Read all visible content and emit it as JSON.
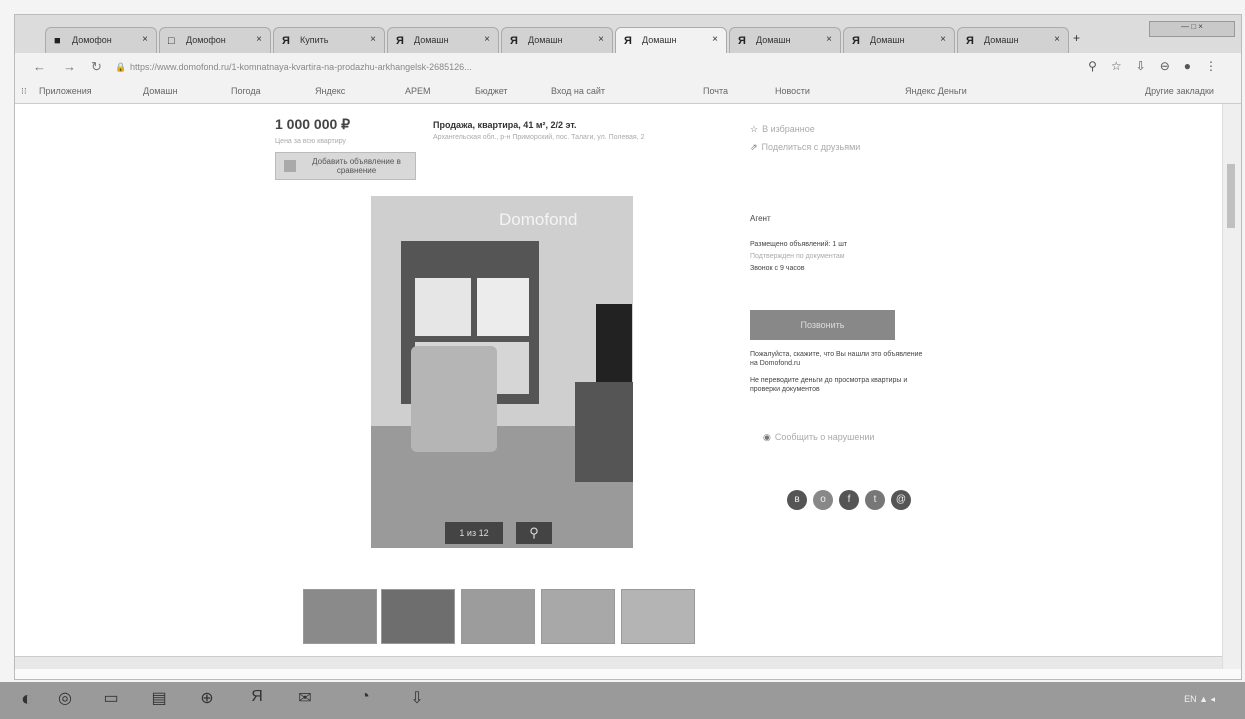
{
  "browser": {
    "tabs": [
      {
        "icon": "■",
        "label": "Домофон"
      },
      {
        "icon": "□",
        "label": "Домофон"
      },
      {
        "icon": "Я",
        "label": "Купить"
      },
      {
        "icon": "Я",
        "label": "Домашн"
      },
      {
        "icon": "Я",
        "label": "Домашн"
      },
      {
        "icon": "Я",
        "label": "Домашн"
      },
      {
        "icon": "Я",
        "label": "Домашн"
      },
      {
        "icon": "Я",
        "label": "Домашн"
      },
      {
        "icon": "Я",
        "label": "Домашн"
      }
    ],
    "active_tab_index": 5,
    "close_glyph": "×",
    "new_tab_glyph": "+",
    "window_controls_label": "— □ ×",
    "url": "https://www.domofond.ru/1-komnatnaya-kvartira-na-prodazhu-arkhangelsk-2685126...",
    "bookmarks": [
      "Приложения",
      "Домашн",
      "Погода",
      "Яндекс",
      "АРЕМ",
      "Бюджет",
      "Вход на сайт",
      "Почта",
      "Новости",
      "Яндекс Деньги"
    ],
    "bookmarks_right": "Другие закладки"
  },
  "listing": {
    "price": "1 000 000 ₽",
    "price_note": "Цена за всю квартиру",
    "compare_label": "Добавить объявление в сравнение",
    "title": "Продажа, квартира, 41 м², 2/2 эт.",
    "address": "Архангельская обл., р-н Приморский, пос. Талаги, ул. Полевая, 2",
    "watermark": "Domofond",
    "photo_counter": "1 из 12",
    "zoom_glyph": "⚲"
  },
  "sidebar": {
    "favorite_label": "В избранное",
    "share_label": "Поделиться с друзьями",
    "section_label": "Агент",
    "posted_label": "Размещено объявлений: 1 шт",
    "rating_label": "Подтвержден по документам",
    "phone_label": "Звонок с 9 часов",
    "contact_button": "Позвонить",
    "note1": "Пожалуйста, скажите, что Вы нашли это объявление на Domofond.ru",
    "note2": "Не переводите деньги до просмотра квартиры и проверки документов",
    "report_label": "Сообщить о нарушении",
    "social_icons": [
      "vk-icon",
      "ok-icon",
      "facebook-icon",
      "twitter-icon",
      "mail-icon"
    ],
    "social_glyphs": [
      "в",
      "о",
      "f",
      "t",
      "@"
    ]
  },
  "taskbar": {
    "icons": [
      "◐",
      "◎",
      "▭",
      "▤",
      "⊕",
      "Я",
      "✉",
      "◔",
      "⇩"
    ],
    "tray_text": "EN ▲ ◂"
  }
}
